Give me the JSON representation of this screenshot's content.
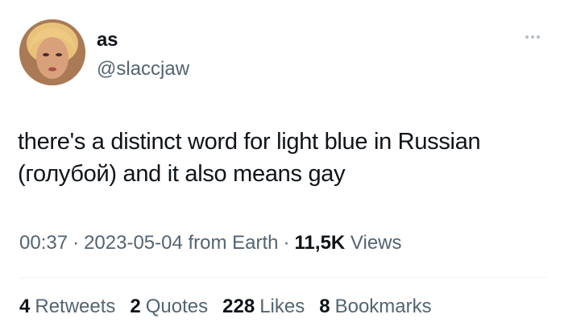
{
  "author": {
    "display_name": "as",
    "handle": "@slaccjaw",
    "avatar_alt": "avatar"
  },
  "more_icon": "more-horizontal-icon",
  "tweet": {
    "text_line1": "there's a distinct word for light blue in Russian",
    "text_line2": "(голубой) and it also means gay"
  },
  "meta": {
    "time": "00:37",
    "separator": "·",
    "date": "2023-05-04",
    "location": "from Earth",
    "views_count": "11,5K",
    "views_label": "Views"
  },
  "stats": {
    "retweets_count": "4",
    "retweets_label": "Retweets",
    "quotes_count": "2",
    "quotes_label": "Quotes",
    "likes_count": "228",
    "likes_label": "Likes",
    "bookmarks_count": "8",
    "bookmarks_label": "Bookmarks"
  },
  "colors": {
    "primary_text": "#0f1419",
    "secondary_text": "#536471",
    "divider": "#eff3f4"
  }
}
